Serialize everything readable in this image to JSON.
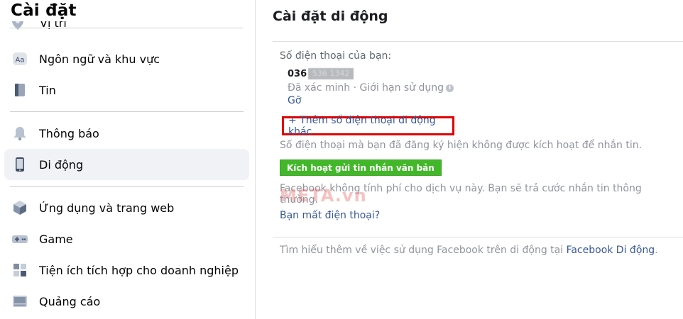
{
  "sidebar": {
    "title": "Cài đặt",
    "cut_item_label": "Vị trí",
    "items": [
      {
        "label": "Ngôn ngữ và khu vực",
        "icon": "aa-icon"
      },
      {
        "label": "Tin",
        "icon": "book-icon"
      },
      {
        "label": "Thông báo",
        "icon": "bell-icon"
      },
      {
        "label": "Di động",
        "icon": "mobile-icon",
        "active": true
      },
      {
        "label": "Ứng dụng và trang web",
        "icon": "cube-icon"
      },
      {
        "label": "Game",
        "icon": "gamepad-icon"
      },
      {
        "label": "Tiện ích tích hợp cho doanh nghiệp",
        "icon": "puzzle-icon"
      },
      {
        "label": "Quảng cáo",
        "icon": "ad-icon"
      }
    ]
  },
  "main": {
    "title": "Cài đặt di động",
    "phone_label": "Số điện thoại của bạn:",
    "phone_prefix": "036",
    "phone_hidden": "536 1342",
    "verified_text": "Đã xác minh · Giới hạn sử dụng",
    "info_glyph": "i",
    "remove_link": "Gỡ",
    "add_phone_link": "+ Thêm số điện thoại di động khác",
    "not_active_text": "Số điện thoại mà bạn đã đăng ký hiện không được kích hoạt để nhắn tin.",
    "activate_button": "Kích hoạt gửi tin nhắn văn bản",
    "no_fee_text": "Facebook không tính phí cho dịch vụ này. Bạn sẽ trả cước nhắn tin thông thường.",
    "watermark": "META.vn",
    "lost_phone_link": "Bạn mất điện thoại?",
    "learn_more_text": "Tìm hiểu thêm về việc sử dụng Facebook trên di động tại",
    "learn_more_link": "Facebook Di động",
    "learn_more_end": "."
  },
  "colors": {
    "link": "#385898",
    "grey_text": "#90949c",
    "green_button": "#42b72a",
    "highlight_border": "#e00000",
    "active_item_bg": "#f0f2f5"
  }
}
